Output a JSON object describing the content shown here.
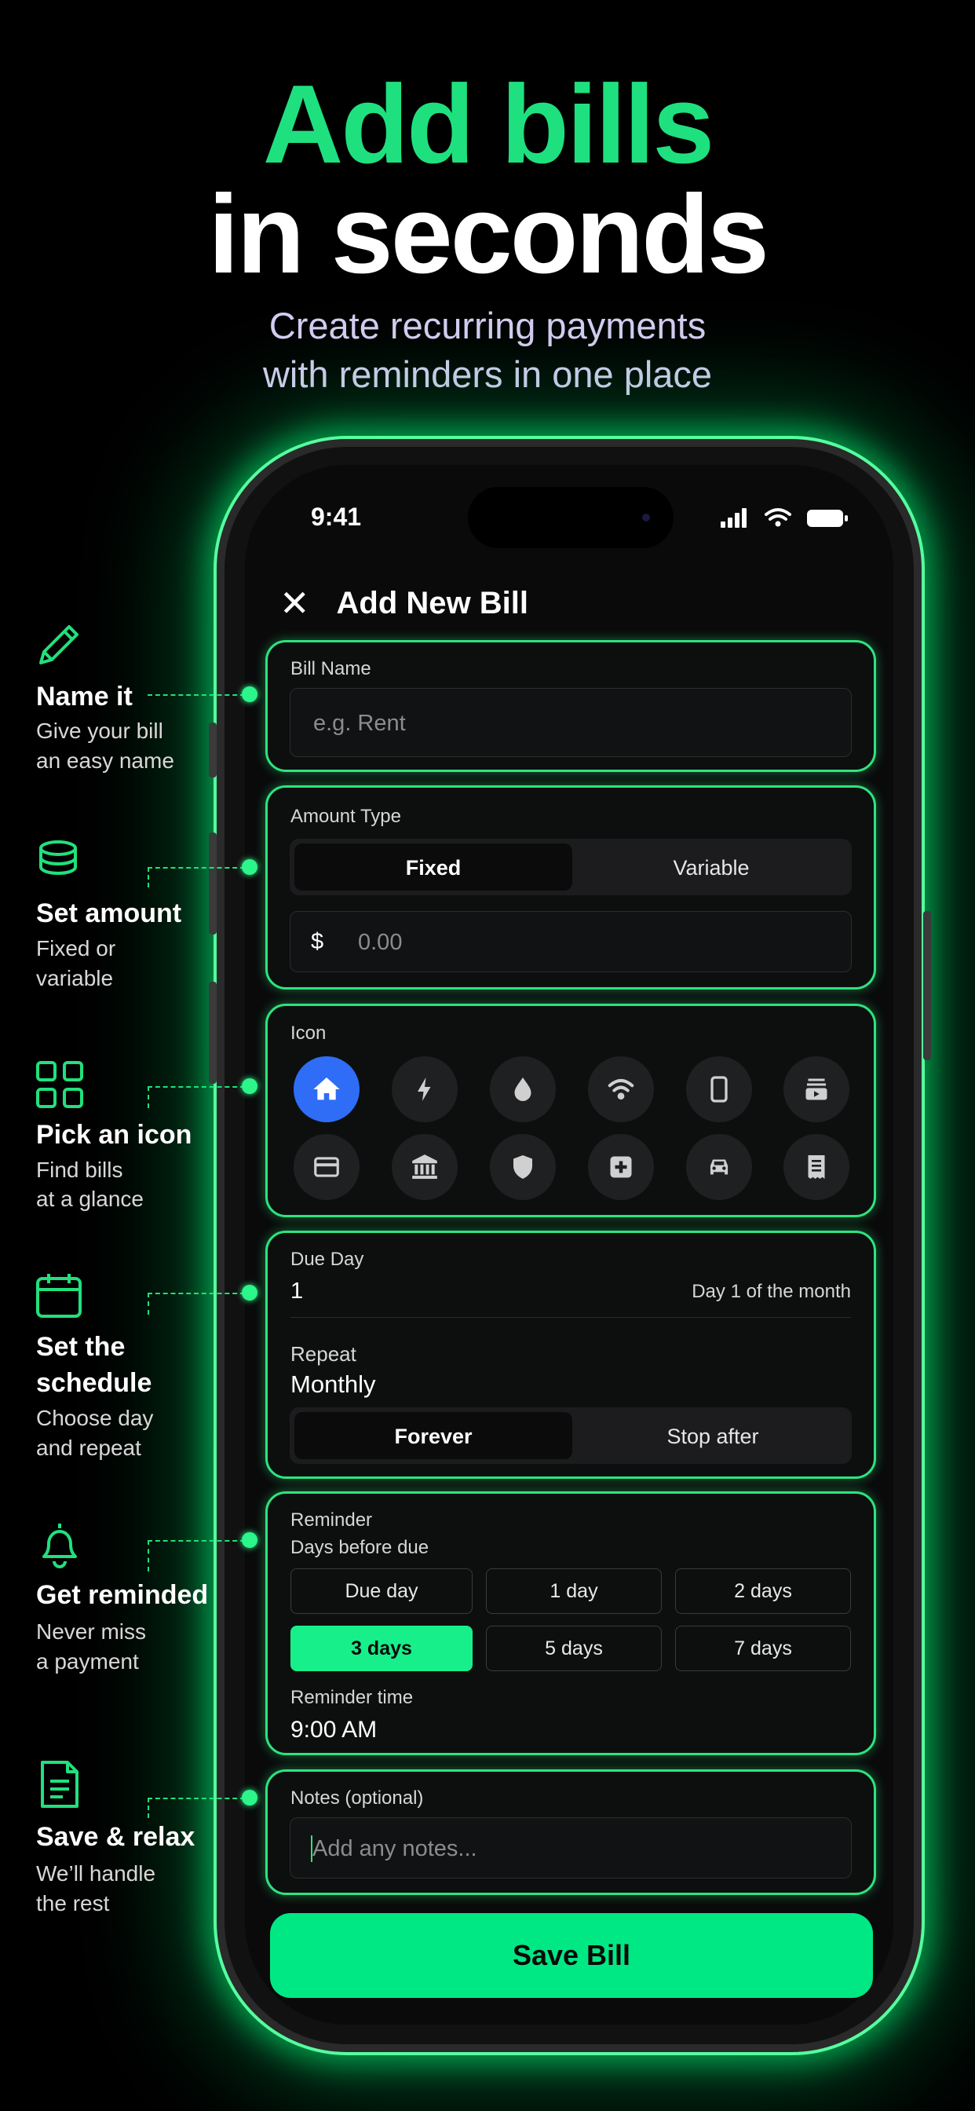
{
  "headline": {
    "line1": "Add bills",
    "line2": "in seconds"
  },
  "subheadline": {
    "line1": "Create recurring payments",
    "line2": "with reminders in one place"
  },
  "colors": {
    "accent": "#00E884",
    "selected_icon": "#2F6DF6",
    "background": "#000000"
  },
  "status_bar": {
    "time": "9:41",
    "icons": [
      "signal-icon",
      "wifi-icon",
      "battery-icon"
    ]
  },
  "screen": {
    "title": "Add New Bill",
    "close_icon": "close-icon",
    "bill_name": {
      "label": "Bill Name",
      "placeholder": "e.g. Rent"
    },
    "amount_type": {
      "label": "Amount Type",
      "options": [
        "Fixed",
        "Variable"
      ],
      "selected": "Fixed",
      "currency": "$",
      "amount_placeholder": "0.00"
    },
    "icon_picker": {
      "label": "Icon",
      "icons": [
        "home-icon",
        "bolt-icon",
        "water-drop-icon",
        "wifi-icon",
        "phone-icon",
        "tv-icon",
        "credit-card-icon",
        "bank-icon",
        "shield-icon",
        "medical-icon",
        "car-icon",
        "receipt-icon"
      ],
      "selected": "home-icon"
    },
    "due_day": {
      "label": "Due Day",
      "value": "1",
      "hint": "Day 1 of the month"
    },
    "repeat": {
      "label": "Repeat",
      "value": "Monthly",
      "options": [
        "Forever",
        "Stop after"
      ],
      "selected": "Forever"
    },
    "reminder": {
      "label": "Reminder",
      "sublabel": "Days before due",
      "options": [
        "Due day",
        "1 day",
        "2 days",
        "3 days",
        "5 days",
        "7 days"
      ],
      "selected": "3 days",
      "time_label": "Reminder time",
      "time_value": "9:00 AM"
    },
    "notes": {
      "label": "Notes (optional)",
      "placeholder": "Add any notes..."
    },
    "save_button": "Save Bill"
  },
  "callouts": [
    {
      "icon": "pencil-icon",
      "title": "Name it",
      "lines": [
        "Give your bill",
        "an easy name"
      ]
    },
    {
      "icon": "coins-icon",
      "title": "Set amount",
      "lines": [
        "Fixed or",
        "variable"
      ]
    },
    {
      "icon": "grid-icon",
      "title": "Pick an icon",
      "lines": [
        "Find bills",
        "at a glance"
      ]
    },
    {
      "icon": "calendar-icon",
      "title_lines": [
        "Set the",
        "schedule"
      ],
      "lines": [
        "Choose day",
        "and repeat"
      ]
    },
    {
      "icon": "bell-icon",
      "title": "Get reminded",
      "lines": [
        "Never miss",
        "a payment"
      ]
    },
    {
      "icon": "document-icon",
      "title": "Save & relax",
      "lines": [
        "We’ll handle",
        "the rest"
      ]
    }
  ]
}
